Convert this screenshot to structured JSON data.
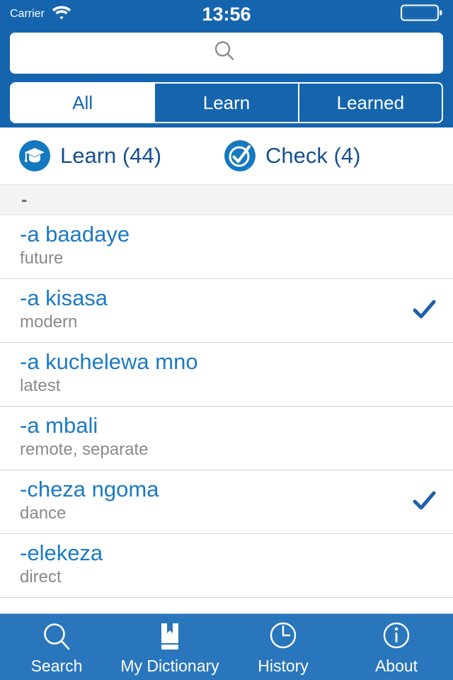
{
  "status_bar": {
    "carrier": "Carrier",
    "wifi_icon": "wifi-icon",
    "time": "13:56",
    "battery_icon": "battery-icon"
  },
  "search": {
    "value": "",
    "placeholder": "",
    "icon": "search-icon"
  },
  "segmented_control": {
    "selected": "All",
    "options": [
      {
        "label": "All",
        "active": true
      },
      {
        "label": "Learn",
        "active": false
      },
      {
        "label": "Learned",
        "active": false
      }
    ]
  },
  "action_bar": {
    "learn": {
      "label": "Learn (44)",
      "icon": "graduation-cap-icon",
      "count": 44
    },
    "check": {
      "label": "Check (4)",
      "icon": "check-circle-icon",
      "count": 4
    }
  },
  "section_header": {
    "label": "-"
  },
  "entries": [
    {
      "word": "-a baadaye",
      "translation": "future",
      "learned": false
    },
    {
      "word": "-a kisasa",
      "translation": "modern",
      "learned": true
    },
    {
      "word": "-a kuchelewa mno",
      "translation": "latest",
      "learned": false
    },
    {
      "word": "-a mbali",
      "translation": "remote, separate",
      "learned": false
    },
    {
      "word": "-cheza ngoma",
      "translation": "dance",
      "learned": true
    },
    {
      "word": "-elekeza",
      "translation": "direct",
      "learned": false
    }
  ],
  "tab_bar": {
    "items": [
      {
        "label": "Search",
        "icon": "magnifier-icon",
        "active": false
      },
      {
        "label": "My Dictionary",
        "icon": "book-icon",
        "active": false
      },
      {
        "label": "History",
        "icon": "clock-icon",
        "active": false
      },
      {
        "label": "About",
        "icon": "info-circle-icon",
        "active": false
      }
    ]
  },
  "colors": {
    "header_blue": "#1565AE",
    "tabbar_blue": "#2A76BC",
    "word_blue": "#1B7AC4",
    "action_blue": "#17508F",
    "check_blue": "#1E5FA8",
    "translation_gray": "#8A8A8A",
    "section_gray": "#F3F3F3"
  }
}
